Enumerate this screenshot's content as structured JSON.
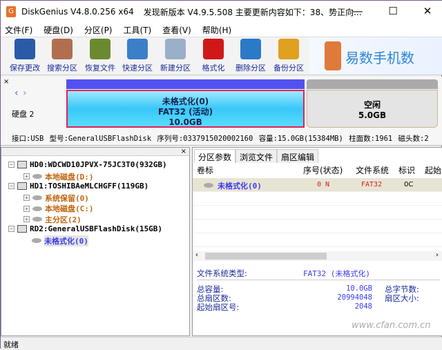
{
  "window": {
    "title": "DiskGenius V4.8.0.256 x64",
    "update_notice": "发现新版本 V4.9.5.508 主要更新内容如下：38、势正向...",
    "minimize": "—",
    "maximize": "☐",
    "close": "✕"
  },
  "menu": [
    "文件(F)",
    "硬盘(D)",
    "分区(P)",
    "工具(T)",
    "查看(V)",
    "帮助(H)"
  ],
  "toolbar": [
    {
      "label": "保存更改",
      "icon": "save-icon",
      "color": "#2a5aa8"
    },
    {
      "label": "搜索分区",
      "icon": "search-icon",
      "color": "#b07050"
    },
    {
      "label": "恢复文件",
      "icon": "recover-icon",
      "color": "#6a8a30"
    },
    {
      "label": "快速分区",
      "icon": "quick-partition-icon",
      "color": "#3a80c8"
    },
    {
      "label": "新建分区",
      "icon": "new-partition-icon",
      "color": "#9ab0c8"
    },
    {
      "label": "格式化",
      "icon": "format-icon",
      "color": "#d01818"
    },
    {
      "label": "删除分区",
      "icon": "delete-icon",
      "color": "#2a7ac8"
    },
    {
      "label": "备份分区",
      "icon": "backup-icon",
      "color": "#e0a020"
    }
  ],
  "banner": {
    "text": "易数手机数"
  },
  "disk": {
    "label": "硬盘 2",
    "partition": {
      "name": "未格式化(0)",
      "fs": "FAT32 (活动)",
      "size": "10.0GB"
    },
    "free": {
      "name": "空闲",
      "size": "5.0GB"
    },
    "info": "接口:USB  型号:GeneralUSBFlashDisk  序列号:0337915020002160  容量:15.0GB(15384MB)  柱面数:1961  磁头数:2"
  },
  "tree": [
    {
      "label": "HD0:WDCWD10JPVX-75JC3T0(932GB)",
      "type": "disk",
      "level": 0
    },
    {
      "label": "本地磁盘(D:)",
      "type": "volume",
      "level": 1
    },
    {
      "label": "HD1:TOSHIBAeMLCHGFF(119GB)",
      "type": "disk",
      "level": 0
    },
    {
      "label": "系统保留(0)",
      "type": "volume",
      "level": 1
    },
    {
      "label": "本地磁盘(C:)",
      "type": "volume",
      "level": 1
    },
    {
      "label": "主分区(2)",
      "type": "volume",
      "level": 1
    },
    {
      "label": "RD2:GeneralUSBFlashDisk(15GB)",
      "type": "disk",
      "level": 0
    },
    {
      "label": "未格式化(0)",
      "type": "volume",
      "level": 1,
      "selected": true
    }
  ],
  "tabs": [
    "分区参数",
    "浏览文件",
    "扇区编辑"
  ],
  "table": {
    "headers": [
      "卷标",
      "序号(状态)",
      "文件系统",
      "标识",
      "起始"
    ],
    "rows": [
      [
        "未格式化(0)",
        "0 N",
        "FAT32",
        "0C",
        ""
      ]
    ]
  },
  "details": {
    "fs_type_label": "文件系统类型:",
    "fs_type_value": "FAT32 (未格式化)",
    "total_capacity_label": "总容量:",
    "total_capacity": "10.0GB",
    "total_sectors_label": "总扇区数:",
    "total_sectors": "20994048",
    "start_sector_label": "起始扇区号:",
    "start_sector": "2048",
    "total_bytes_label": "总字节数:",
    "sector_size_label": "扇区大小:"
  },
  "status": "就绪",
  "watermark": "www.cfan.com.cn"
}
